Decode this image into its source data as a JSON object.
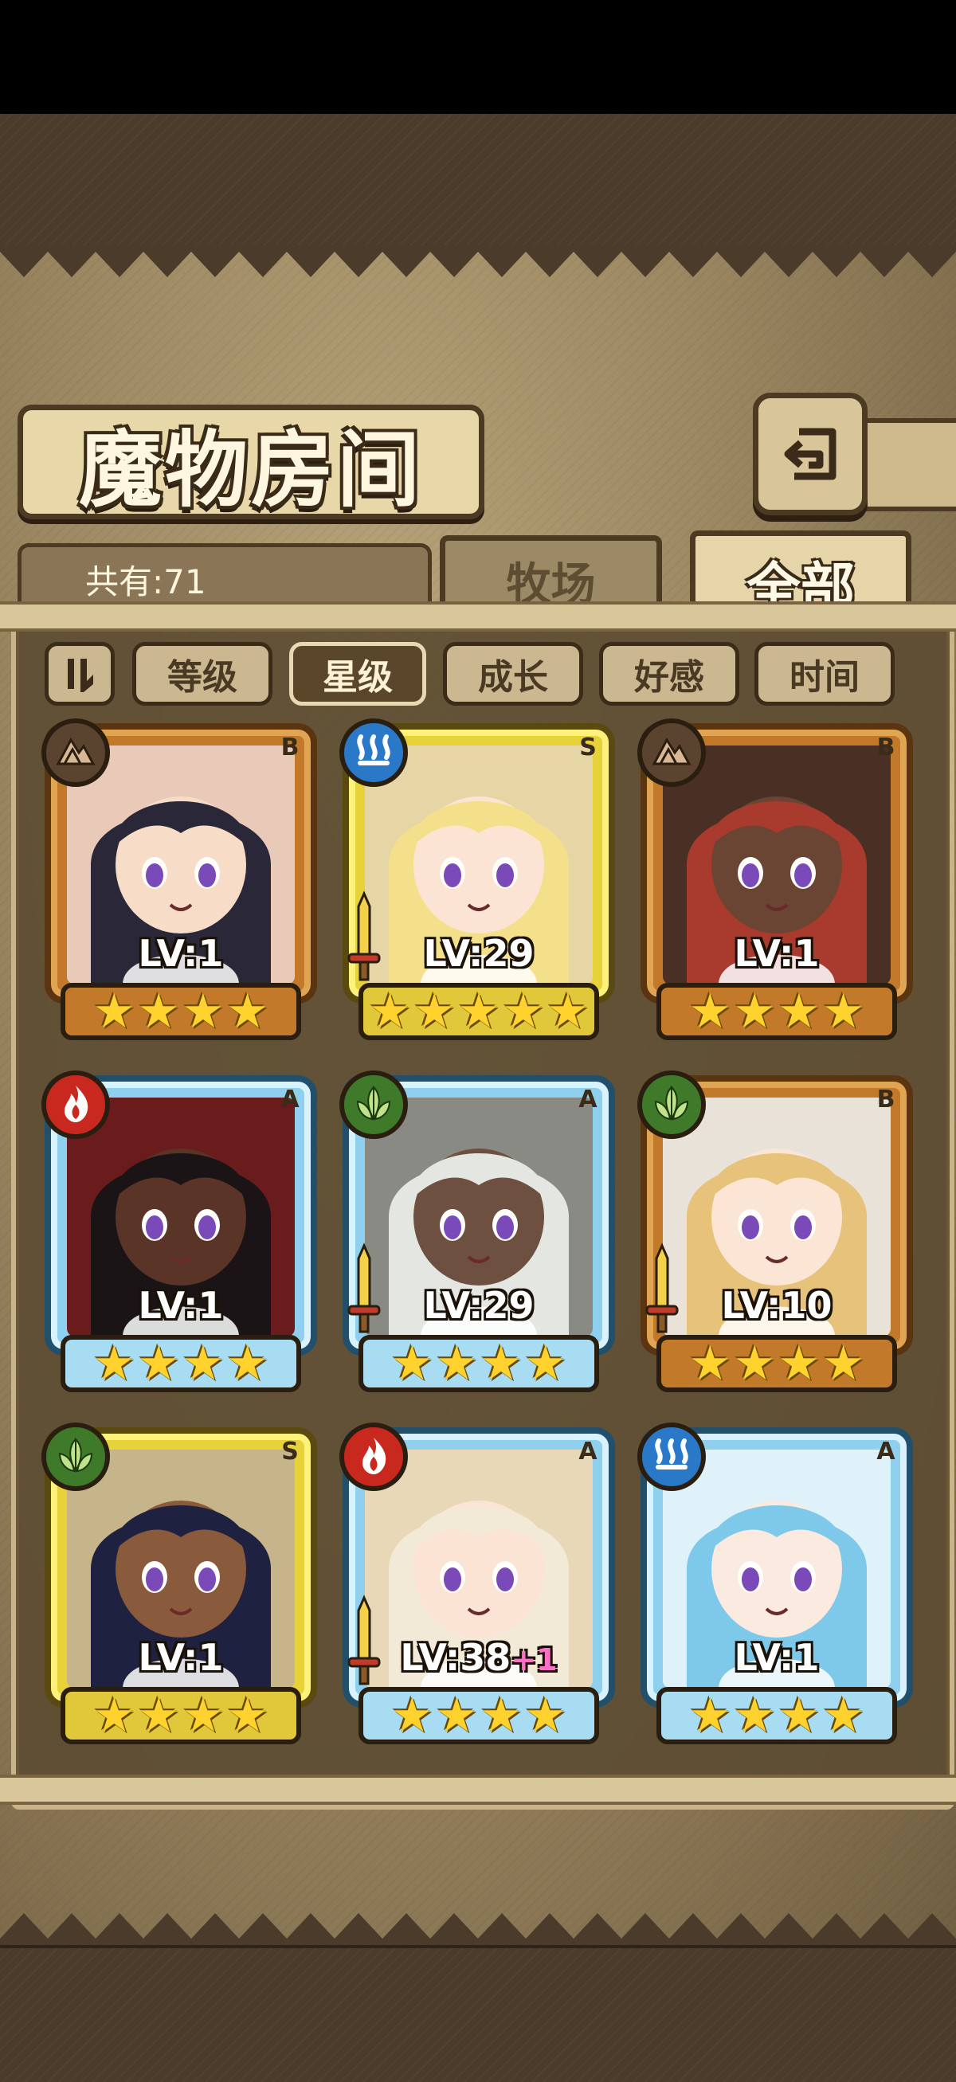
{
  "header": {
    "title": "魔物房间"
  },
  "tabs": {
    "count_label": "共有:71",
    "ranch": "牧场",
    "all": "全部"
  },
  "sort": [
    {
      "label": "等级",
      "active": false
    },
    {
      "label": "星级",
      "active": true
    },
    {
      "label": "成长",
      "active": false
    },
    {
      "label": "好感",
      "active": false
    },
    {
      "label": "时间",
      "active": false
    }
  ],
  "cards": [
    {
      "level": "LV:1",
      "plus": "",
      "rank": "B",
      "stars": 4,
      "frame": "brown",
      "element": "earth-icon",
      "weapon": false,
      "hair": "#2a2838",
      "skin": "#f7dcc8",
      "bg": "#e9c9b8"
    },
    {
      "level": "LV:29",
      "plus": "",
      "rank": "S",
      "stars": 5,
      "frame": "gold",
      "element": "water-icon",
      "weapon": true,
      "hair": "#f4e08a",
      "skin": "#fbe4d4",
      "bg": "#e6d6a6"
    },
    {
      "level": "LV:1",
      "plus": "",
      "rank": "B",
      "stars": 4,
      "frame": "brown",
      "element": "earth-icon",
      "weapon": false,
      "hair": "#a83a2e",
      "skin": "#6a4534",
      "bg": "#4a3024"
    },
    {
      "level": "LV:1",
      "plus": "",
      "rank": "A",
      "stars": 4,
      "frame": "blue",
      "element": "fire-icon",
      "weapon": false,
      "hair": "#1a1416",
      "skin": "#5a3426",
      "bg": "#6a1c1c"
    },
    {
      "level": "LV:29",
      "plus": "",
      "rank": "A",
      "stars": 4,
      "frame": "blue",
      "element": "leaf-icon",
      "weapon": true,
      "hair": "#e4e6e2",
      "skin": "#6e5040",
      "bg": "#8a8a84"
    },
    {
      "level": "LV:10",
      "plus": "",
      "rank": "B",
      "stars": 4,
      "frame": "brown",
      "element": "leaf-icon",
      "weapon": true,
      "hair": "#e6c27a",
      "skin": "#fbe6d6",
      "bg": "#e8e2d8"
    },
    {
      "level": "LV:1",
      "plus": "",
      "rank": "S",
      "stars": 4,
      "frame": "gold",
      "element": "leaf-icon",
      "weapon": false,
      "hair": "#1e2240",
      "skin": "#8a5a3c",
      "bg": "#c6b48a"
    },
    {
      "level": "LV:38",
      "plus": "+1",
      "rank": "A",
      "stars": 4,
      "frame": "blue",
      "element": "fire-icon",
      "weapon": true,
      "hair": "#f2ead6",
      "skin": "#fbe4d4",
      "bg": "#e8d8b8"
    },
    {
      "level": "LV:1",
      "plus": "",
      "rank": "A",
      "stars": 4,
      "frame": "blue",
      "element": "water-icon",
      "weapon": false,
      "hair": "#7ec8ea",
      "skin": "#fbeadf",
      "bg": "#dff2fa"
    }
  ]
}
